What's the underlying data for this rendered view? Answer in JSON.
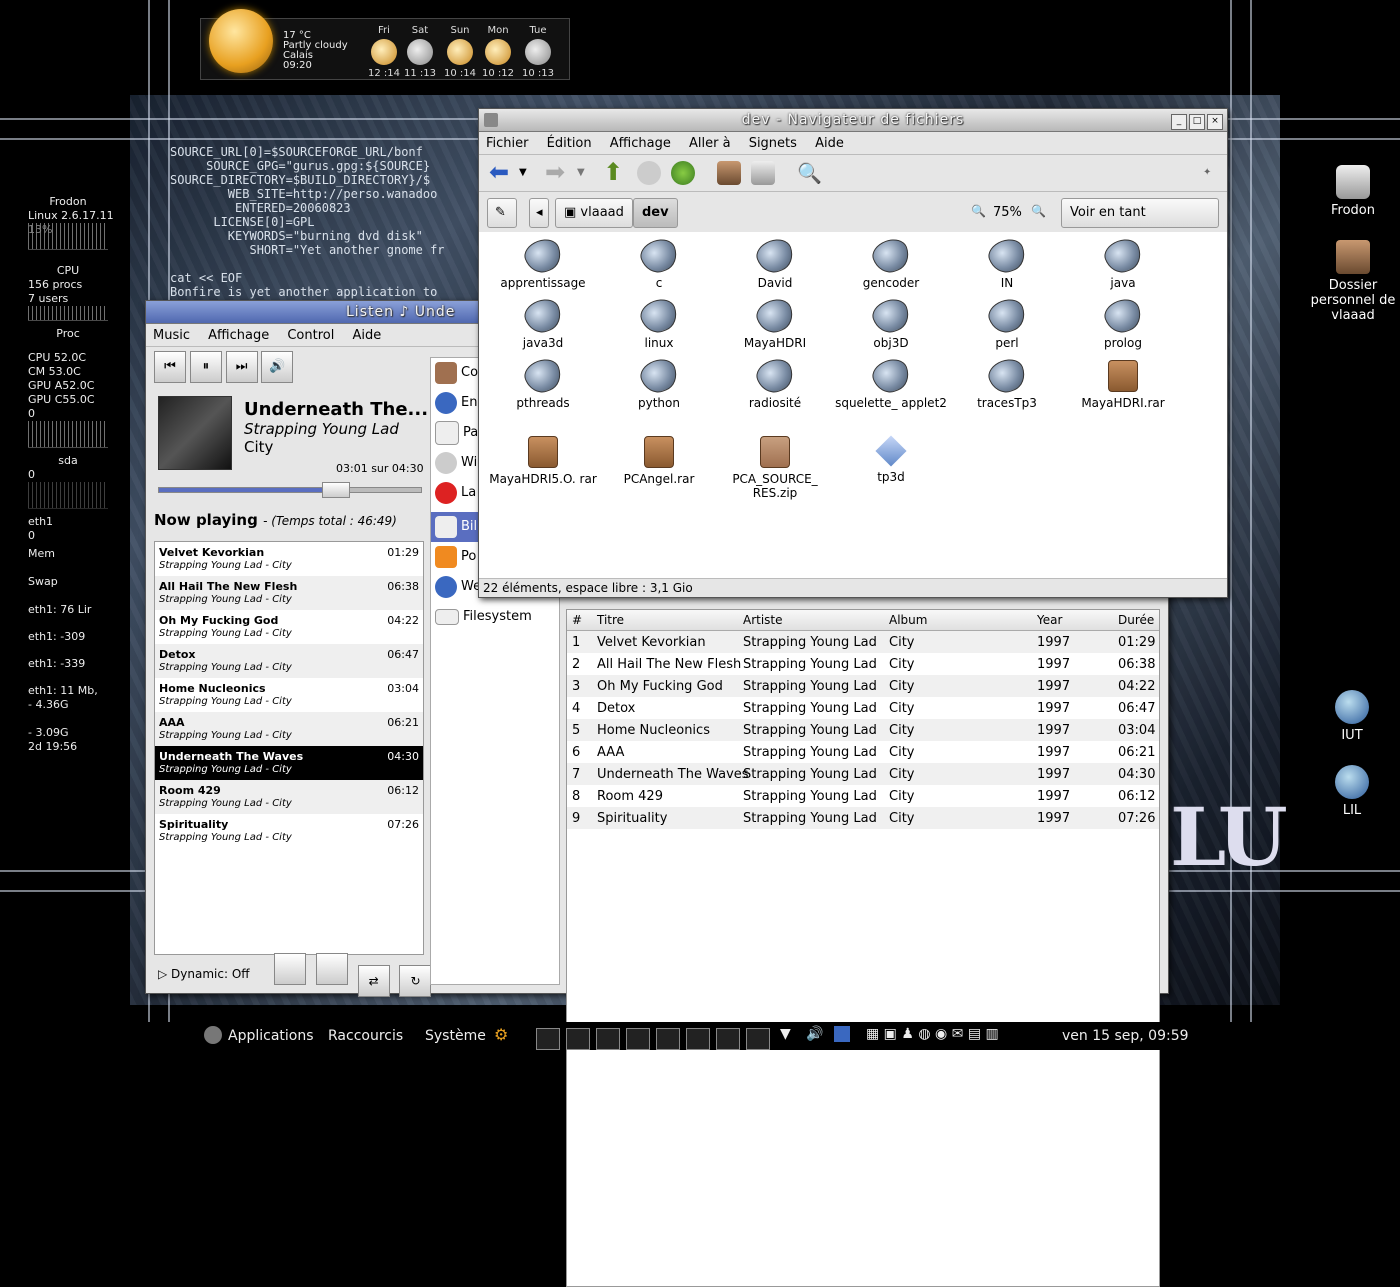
{
  "weather": {
    "current": {
      "temp": "17 °C",
      "condition": "Partly cloudy",
      "city": "Calais",
      "time": "09:20"
    },
    "days": [
      {
        "day": "Fri",
        "range": "12 :14"
      },
      {
        "day": "Sat",
        "range": "11 :13"
      },
      {
        "day": "Sun",
        "range": "10 :14"
      },
      {
        "day": "Mon",
        "range": "10 :12"
      },
      {
        "day": "Tue",
        "range": "10 :13"
      }
    ]
  },
  "terminal": {
    "lines": "SOURCE_URL[0]=$SOURCEFORGE_URL/bonf\n     SOURCE_GPG=\"gurus.gpg:${SOURCE}\nSOURCE_DIRECTORY=$BUILD_DIRECTORY}/$\n        WEB_SITE=http://perso.wanadoo\n         ENTERED=20060823\n      LICENSE[0]=GPL\n        KEYWORDS=\"burning dvd disk\"\n           SHORT=\"Yet another gnome fr\n\ncat << EOF\nBonfire is yet another application to\ndesigned to be as simple as possible a"
  },
  "conky": {
    "host": "Frodon",
    "kernel": "Linux 2.6.17.11",
    "cpu_pct": "13%",
    "cpu_label": "CPU",
    "procs": "156 procs",
    "users": "7 users",
    "proc_label": "Proc",
    "temps": [
      "CPU    52.0C",
      "CM      53.0C",
      "GPU A52.0C",
      "GPU C55.0C"
    ],
    "zero1": "0",
    "sda": "sda",
    "zero2": "0",
    "eth1": "eth1",
    "zero3": "0",
    "mem": "Mem",
    "swap": "Swap",
    "eth1_a": "eth1:  76  Lir",
    "eth1_b": "eth1:  -309",
    "eth1_c": "eth1:  -339",
    "eth1_d": "eth1:  11  Mb,",
    "disk1": "-  4.36G",
    "disk2": "-  3.09G",
    "uptime": "2d  19:56"
  },
  "desktop_icons": [
    {
      "label": "Frodon",
      "icon": "computer-icon"
    },
    {
      "label": "Dossier personnel de vlaaad",
      "icon": "home-icon"
    },
    {
      "label": "IUT",
      "icon": "globe-icon"
    },
    {
      "label": "LIL",
      "icon": "globe-icon"
    }
  ],
  "desktop_text": "LU",
  "nautilus": {
    "title": "dev - Navigateur de fichiers",
    "menu": [
      "Fichier",
      "Édition",
      "Affichage",
      "Aller à",
      "Signets",
      "Aide"
    ],
    "path": [
      "vlaaad",
      "dev"
    ],
    "zoom": "75%",
    "view_mode": "Voir en tant qu'icônes",
    "files": [
      {
        "name": "apprentissage",
        "type": "folder"
      },
      {
        "name": "c",
        "type": "folder"
      },
      {
        "name": "David",
        "type": "folder"
      },
      {
        "name": "gencoder",
        "type": "folder"
      },
      {
        "name": "IN",
        "type": "folder"
      },
      {
        "name": "java",
        "type": "folder"
      },
      {
        "name": "java3d",
        "type": "folder"
      },
      {
        "name": "linux",
        "type": "folder"
      },
      {
        "name": "MayaHDRI",
        "type": "folder"
      },
      {
        "name": "obj3D",
        "type": "folder"
      },
      {
        "name": "perl",
        "type": "folder"
      },
      {
        "name": "prolog",
        "type": "folder"
      },
      {
        "name": "pthreads",
        "type": "folder"
      },
      {
        "name": "python",
        "type": "folder"
      },
      {
        "name": "radiosité",
        "type": "folder"
      },
      {
        "name": "squelette_ applet2",
        "type": "folder"
      },
      {
        "name": "tracesTp3",
        "type": "folder"
      },
      {
        "name": "MayaHDRI.rar",
        "type": "rar"
      },
      {
        "name": "MayaHDRI5.O. rar",
        "type": "rar"
      },
      {
        "name": "PCAngel.rar",
        "type": "rar"
      },
      {
        "name": "PCA_SOURCE_ RES.zip",
        "type": "zip"
      },
      {
        "name": "tp3d",
        "type": "tp3d"
      }
    ],
    "status": "22 éléments, espace libre : 3,1 Gio"
  },
  "listen": {
    "title": "Listen ♪ Unde",
    "menu": [
      "Music",
      "Affichage",
      "Control",
      "Aide"
    ],
    "now": {
      "title": "Underneath The...",
      "artist": "Strapping Young Lad",
      "album": "City",
      "time": "03:01 sur 04:30",
      "progress": 0.67
    },
    "now_playing_label": "Now playing",
    "total_label": "- (Temps total : 46:49)",
    "dynamic": "Dynamic: Off",
    "sources": [
      "Co",
      "En",
      "Pa",
      "Wi",
      "La",
      "Bil",
      "Po",
      "We",
      "Filesystem"
    ],
    "tracks": [
      {
        "title": "Velvet Kevorkian",
        "sub": "Strapping Young Lad - City",
        "dur": "01:29"
      },
      {
        "title": "All Hail The New Flesh",
        "sub": "Strapping Young Lad - City",
        "dur": "06:38"
      },
      {
        "title": "Oh My Fucking God",
        "sub": "Strapping Young Lad - City",
        "dur": "04:22"
      },
      {
        "title": "Detox",
        "sub": "Strapping Young Lad - City",
        "dur": "06:47"
      },
      {
        "title": "Home Nucleonics",
        "sub": "Strapping Young Lad - City",
        "dur": "03:04"
      },
      {
        "title": "AAA",
        "sub": "Strapping Young Lad - City",
        "dur": "06:21"
      },
      {
        "title": "Underneath The Waves",
        "sub": "Strapping Young Lad - City",
        "dur": "04:30"
      },
      {
        "title": "Room 429",
        "sub": "Strapping Young Lad - City",
        "dur": "06:12"
      },
      {
        "title": "Spirituality",
        "sub": "Strapping Young Lad - City",
        "dur": "07:26"
      }
    ],
    "columns": [
      "#",
      "Titre",
      "Artiste",
      "Album",
      "Year",
      "Durée"
    ],
    "rows": [
      [
        "1",
        "Velvet Kevorkian",
        "Strapping Young Lad",
        "City",
        "1997",
        "01:29"
      ],
      [
        "2",
        "All Hail The New Flesh",
        "Strapping Young Lad",
        "City",
        "1997",
        "06:38"
      ],
      [
        "3",
        "Oh My Fucking God",
        "Strapping Young Lad",
        "City",
        "1997",
        "04:22"
      ],
      [
        "4",
        "Detox",
        "Strapping Young Lad",
        "City",
        "1997",
        "06:47"
      ],
      [
        "5",
        "Home Nucleonics",
        "Strapping Young Lad",
        "City",
        "1997",
        "03:04"
      ],
      [
        "6",
        "AAA",
        "Strapping Young Lad",
        "City",
        "1997",
        "06:21"
      ],
      [
        "7",
        "Underneath The Waves",
        "Strapping Young Lad",
        "City",
        "1997",
        "04:30"
      ],
      [
        "8",
        "Room 429",
        "Strapping Young Lad",
        "City",
        "1997",
        "06:12"
      ],
      [
        "9",
        "Spirituality",
        "Strapping Young Lad",
        "City",
        "1997",
        "07:26"
      ]
    ]
  },
  "panel": {
    "applications": "Applications",
    "raccourcis": "Raccourcis",
    "systeme": "Système",
    "clock": "ven 15 sep, 09:59"
  }
}
